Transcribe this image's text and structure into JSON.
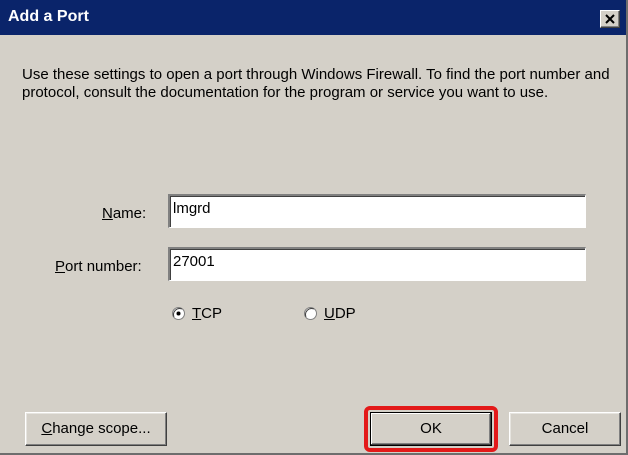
{
  "window": {
    "title": "Add a Port"
  },
  "dialog": {
    "description": "Use these settings to open a port through Windows Firewall. To find the port number and protocol, consult the documentation for the program or service you want to use."
  },
  "fields": {
    "name": {
      "label_accel": "N",
      "label_rest": "ame:",
      "value": "lmgrd"
    },
    "port": {
      "label_accel": "P",
      "label_rest": "ort number:",
      "value": "27001"
    }
  },
  "protocol": {
    "tcp": {
      "label_accel": "T",
      "label_rest": "CP",
      "selected": true
    },
    "udp": {
      "label_accel": "U",
      "label_rest": "DP",
      "selected": false
    }
  },
  "buttons": {
    "change_scope": {
      "label_accel": "C",
      "label_rest": "hange scope..."
    },
    "ok": {
      "label": "OK"
    },
    "cancel": {
      "label": "Cancel"
    }
  },
  "annotation": {
    "highlight_color": "#e31919",
    "highlighted_control": "ok-button"
  }
}
